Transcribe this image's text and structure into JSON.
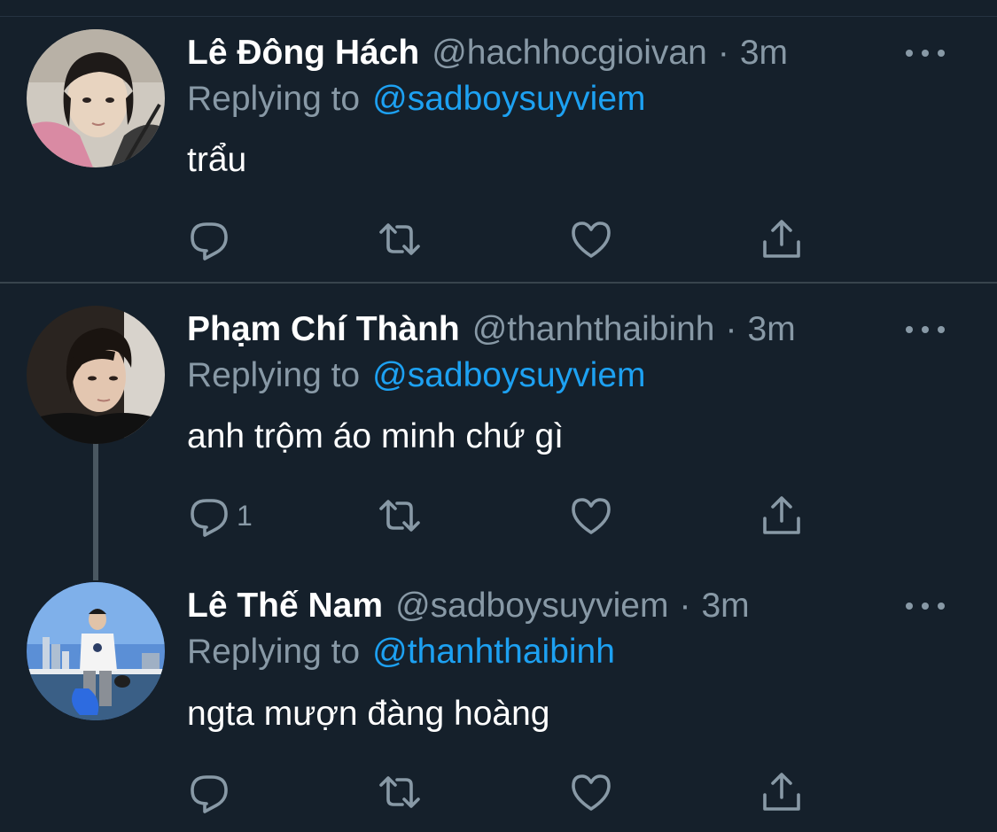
{
  "colors": {
    "background": "#15202b",
    "primary_text": "#ffffff",
    "secondary_text": "#8899a6",
    "link": "#1da1f2",
    "divider": "#38444d"
  },
  "icons": {
    "reply": "reply-icon",
    "retweet": "retweet-icon",
    "like": "heart-icon",
    "share": "share-icon",
    "more": "more-icon"
  },
  "tweets": [
    {
      "display_name": "Lê Đông Hách",
      "handle": "@hachhocgioivan",
      "separator": "·",
      "time": "3m",
      "replying_prefix": "Replying to",
      "replying_to": "@sadboysuyviem",
      "text": "trẩu",
      "reply_count": ""
    },
    {
      "display_name": "Phạm Chí Thành",
      "handle": "@thanhthaibinh",
      "separator": "·",
      "time": "3m",
      "replying_prefix": "Replying to",
      "replying_to": "@sadboysuyviem",
      "text": "anh trộm áo minh chứ gì",
      "reply_count": "1"
    },
    {
      "display_name": "Lê Thế Nam",
      "handle": "@sadboysuyviem",
      "separator": "·",
      "time": "3m",
      "replying_prefix": "Replying to",
      "replying_to": "@thanhthaibinh",
      "text": "ngta mượn đàng hoàng",
      "reply_count": ""
    }
  ]
}
